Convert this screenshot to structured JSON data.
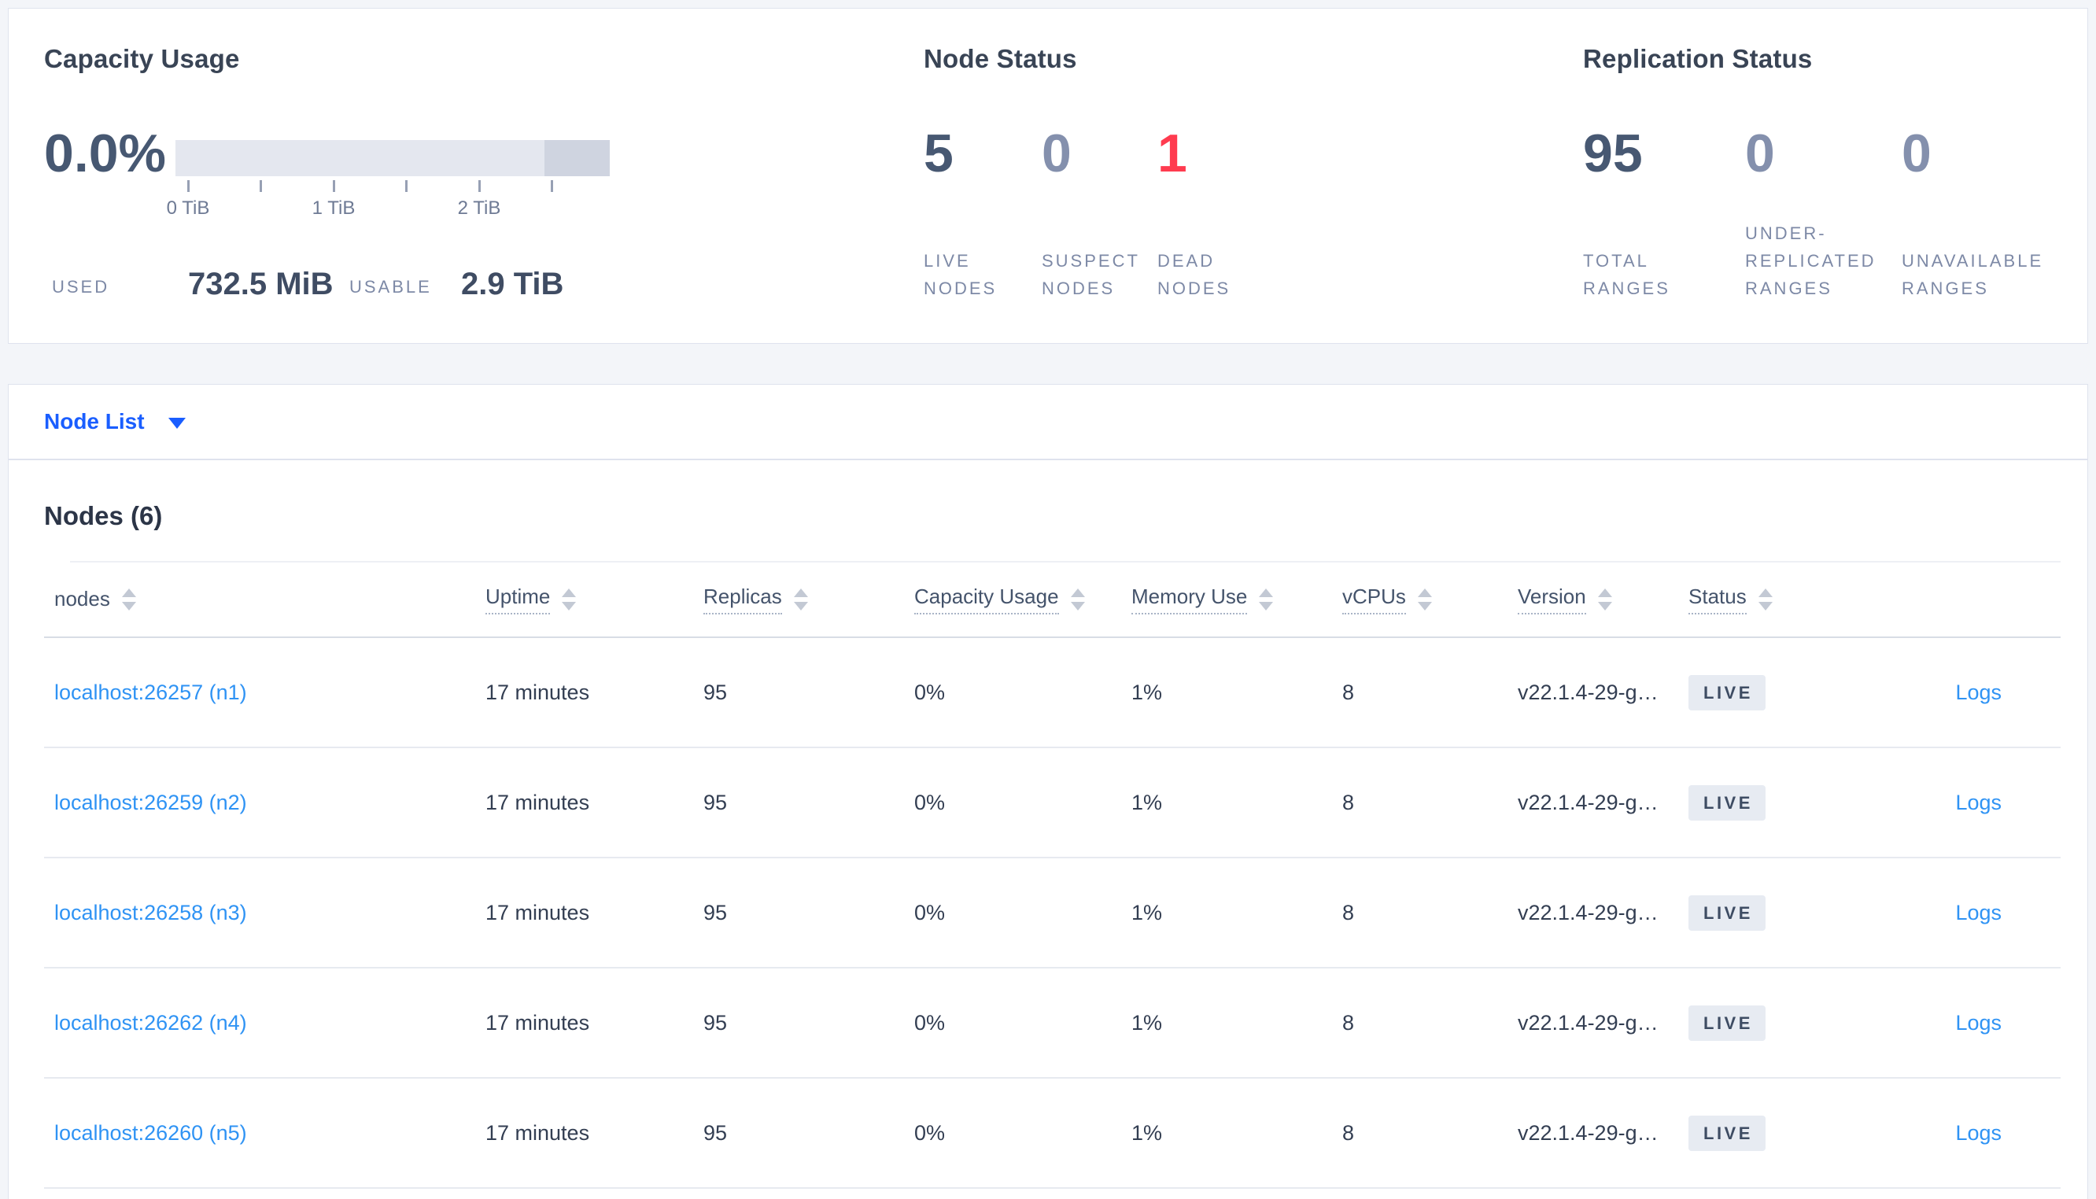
{
  "colors": {
    "page_background": "#f3f5f9",
    "card_border": "#dfe3ee",
    "primary_number": "#475872",
    "muted_number": "#8490ad",
    "danger_number": "#ff3b4f",
    "label_gray": "#7d89a6",
    "table_link_blue": "#2f93f4",
    "nodelist_blue": "#1a5eff",
    "bar_track": "#e4e7ef",
    "bar_tail": "#cfd4e0",
    "badge_background": "#e7ebf2"
  },
  "summary": {
    "capacity": {
      "title": "Capacity Usage",
      "percent": "0.0%",
      "tick_labels": [
        "0 TiB",
        "1 TiB",
        "2 TiB"
      ],
      "used_label": "USED",
      "used_value": "732.5 MiB",
      "usable_label": "USABLE",
      "usable_value": "2.9 TiB"
    },
    "node_status": {
      "title": "Node Status",
      "stats": [
        {
          "value": "5",
          "label": "LIVE NODES"
        },
        {
          "value": "0",
          "label": "SUSPECT NODES"
        },
        {
          "value": "1",
          "label": "DEAD NODES"
        }
      ]
    },
    "replication": {
      "title": "Replication Status",
      "stats": [
        {
          "value": "95",
          "label": "TOTAL RANGES"
        },
        {
          "value": "0",
          "label": "UNDER-REPLICATED RANGES"
        },
        {
          "value": "0",
          "label": "UNAVAILABLE RANGES"
        }
      ]
    }
  },
  "nodelist": {
    "label": "Node List"
  },
  "table": {
    "title": "Nodes (6)",
    "columns": [
      {
        "label": "nodes"
      },
      {
        "label": "Uptime"
      },
      {
        "label": "Replicas"
      },
      {
        "label": "Capacity Usage"
      },
      {
        "label": "Memory Use"
      },
      {
        "label": "vCPUs"
      },
      {
        "label": "Version"
      },
      {
        "label": "Status"
      }
    ],
    "rows": [
      {
        "address": "localhost:26257 (n1)",
        "uptime": "17 minutes",
        "replicas": "95",
        "capacity": "0%",
        "memory": "1%",
        "vcpus": "8",
        "version": "v22.1.4-29-g…",
        "status": "LIVE",
        "logs": "Logs"
      },
      {
        "address": "localhost:26259 (n2)",
        "uptime": "17 minutes",
        "replicas": "95",
        "capacity": "0%",
        "memory": "1%",
        "vcpus": "8",
        "version": "v22.1.4-29-g…",
        "status": "LIVE",
        "logs": "Logs"
      },
      {
        "address": "localhost:26258 (n3)",
        "uptime": "17 minutes",
        "replicas": "95",
        "capacity": "0%",
        "memory": "1%",
        "vcpus": "8",
        "version": "v22.1.4-29-g…",
        "status": "LIVE",
        "logs": "Logs"
      },
      {
        "address": "localhost:26262 (n4)",
        "uptime": "17 minutes",
        "replicas": "95",
        "capacity": "0%",
        "memory": "1%",
        "vcpus": "8",
        "version": "v22.1.4-29-g…",
        "status": "LIVE",
        "logs": "Logs"
      },
      {
        "address": "localhost:26260 (n5)",
        "uptime": "17 minutes",
        "replicas": "95",
        "capacity": "0%",
        "memory": "1%",
        "vcpus": "8",
        "version": "v22.1.4-29-g…",
        "status": "LIVE",
        "logs": "Logs"
      }
    ]
  }
}
